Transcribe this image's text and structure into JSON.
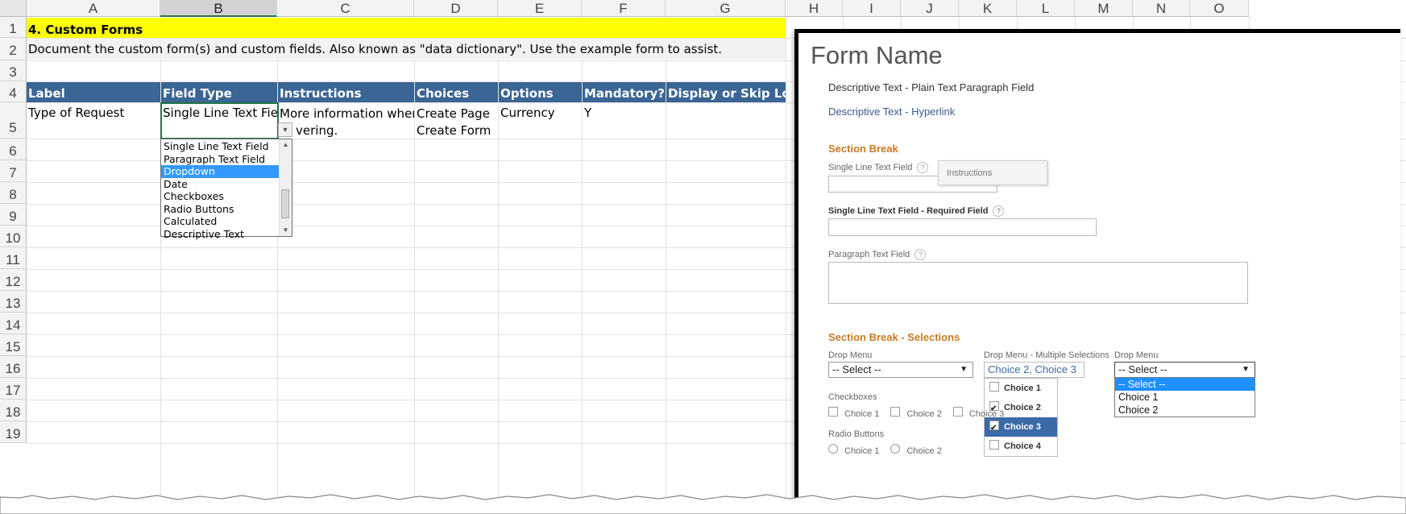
{
  "columns": [
    "A",
    "B",
    "C",
    "D",
    "E",
    "F",
    "G",
    "H",
    "I",
    "J",
    "K",
    "L",
    "M",
    "N",
    "O"
  ],
  "selected_column": "B",
  "rows": [
    "1",
    "2",
    "3",
    "4",
    "5",
    "6",
    "7",
    "8",
    "9",
    "10",
    "11",
    "12",
    "13",
    "14",
    "15",
    "16",
    "17",
    "18",
    "19"
  ],
  "sheet": {
    "title": "4. Custom Forms",
    "description": "Document the custom form(s) and custom fields. Also known as \"data dictionary\". Use the example form to assist.",
    "headers": [
      "Label",
      "Field Type",
      "Instructions",
      "Choices",
      "Options",
      "Mandatory?",
      "Display or Skip Logic"
    ],
    "row5": {
      "label": "Type of Request",
      "field_type": "Single Line Text Field",
      "instructions_line1": "More information when",
      "instructions_line2": "vering.",
      "choices_line1": "Create Page",
      "choices_line2": "Create Form",
      "options": "Currency",
      "mandatory": "Y"
    },
    "validation_list": {
      "items": [
        "Single Line Text Field",
        "Paragraph Text Field",
        "Dropdown",
        "Date",
        "Checkboxes",
        "Radio Buttons",
        "Calculated",
        "Descriptive Text"
      ],
      "selected": "Dropdown"
    }
  },
  "form": {
    "title": "Form Name",
    "plain_text": "Descriptive Text - Plain Text Paragraph Field",
    "hyperlink": "Descriptive Text - Hyperlink",
    "section1": "Section Break",
    "single_line_label": "Single Line Text Field",
    "qmark": "?",
    "tooltip": "Instructions",
    "required_label": "Single Line Text Field - Required Field",
    "paragraph_label": "Paragraph Text Field",
    "section2": "Section Break - Selections",
    "drop_menu_label": "Drop Menu",
    "drop_menu_value": "-- Select --",
    "multi_label": "Drop Menu - Multiple Selections",
    "multi_value": "Choice 2, Choice 3",
    "multi_items": [
      "Choice 1",
      "Choice 2",
      "Choice 3",
      "Choice 4"
    ],
    "drop3_label": "Drop Menu",
    "drop3_value": "-- Select --",
    "drop3_items": [
      "-- Select --",
      "Choice 1",
      "Choice 2"
    ],
    "checkboxes_label": "Checkboxes",
    "checkbox_items": [
      "Choice 1",
      "Choice 2",
      "Choice 3"
    ],
    "radio_label": "Radio Buttons",
    "radio_items": [
      "Choice 1",
      "Choice 2"
    ]
  }
}
